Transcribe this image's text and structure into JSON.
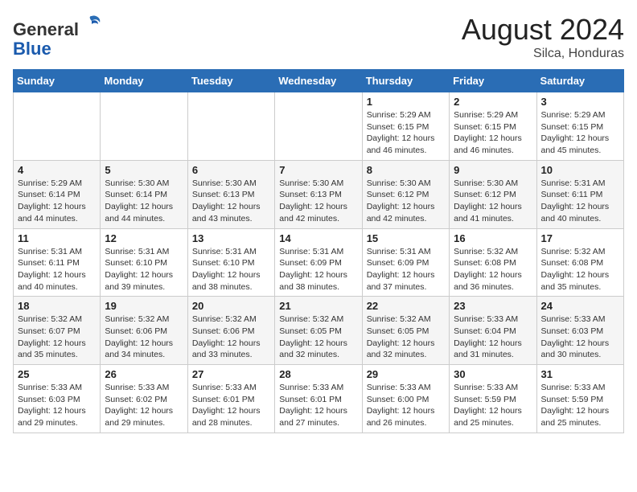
{
  "header": {
    "logo_line1": "General",
    "logo_line2": "Blue",
    "month_year": "August 2024",
    "location": "Silca, Honduras"
  },
  "days_of_week": [
    "Sunday",
    "Monday",
    "Tuesday",
    "Wednesday",
    "Thursday",
    "Friday",
    "Saturday"
  ],
  "weeks": [
    [
      {
        "day": "",
        "info": ""
      },
      {
        "day": "",
        "info": ""
      },
      {
        "day": "",
        "info": ""
      },
      {
        "day": "",
        "info": ""
      },
      {
        "day": "1",
        "info": "Sunrise: 5:29 AM\nSunset: 6:15 PM\nDaylight: 12 hours\nand 46 minutes."
      },
      {
        "day": "2",
        "info": "Sunrise: 5:29 AM\nSunset: 6:15 PM\nDaylight: 12 hours\nand 46 minutes."
      },
      {
        "day": "3",
        "info": "Sunrise: 5:29 AM\nSunset: 6:15 PM\nDaylight: 12 hours\nand 45 minutes."
      }
    ],
    [
      {
        "day": "4",
        "info": "Sunrise: 5:29 AM\nSunset: 6:14 PM\nDaylight: 12 hours\nand 44 minutes."
      },
      {
        "day": "5",
        "info": "Sunrise: 5:30 AM\nSunset: 6:14 PM\nDaylight: 12 hours\nand 44 minutes."
      },
      {
        "day": "6",
        "info": "Sunrise: 5:30 AM\nSunset: 6:13 PM\nDaylight: 12 hours\nand 43 minutes."
      },
      {
        "day": "7",
        "info": "Sunrise: 5:30 AM\nSunset: 6:13 PM\nDaylight: 12 hours\nand 42 minutes."
      },
      {
        "day": "8",
        "info": "Sunrise: 5:30 AM\nSunset: 6:12 PM\nDaylight: 12 hours\nand 42 minutes."
      },
      {
        "day": "9",
        "info": "Sunrise: 5:30 AM\nSunset: 6:12 PM\nDaylight: 12 hours\nand 41 minutes."
      },
      {
        "day": "10",
        "info": "Sunrise: 5:31 AM\nSunset: 6:11 PM\nDaylight: 12 hours\nand 40 minutes."
      }
    ],
    [
      {
        "day": "11",
        "info": "Sunrise: 5:31 AM\nSunset: 6:11 PM\nDaylight: 12 hours\nand 40 minutes."
      },
      {
        "day": "12",
        "info": "Sunrise: 5:31 AM\nSunset: 6:10 PM\nDaylight: 12 hours\nand 39 minutes."
      },
      {
        "day": "13",
        "info": "Sunrise: 5:31 AM\nSunset: 6:10 PM\nDaylight: 12 hours\nand 38 minutes."
      },
      {
        "day": "14",
        "info": "Sunrise: 5:31 AM\nSunset: 6:09 PM\nDaylight: 12 hours\nand 38 minutes."
      },
      {
        "day": "15",
        "info": "Sunrise: 5:31 AM\nSunset: 6:09 PM\nDaylight: 12 hours\nand 37 minutes."
      },
      {
        "day": "16",
        "info": "Sunrise: 5:32 AM\nSunset: 6:08 PM\nDaylight: 12 hours\nand 36 minutes."
      },
      {
        "day": "17",
        "info": "Sunrise: 5:32 AM\nSunset: 6:08 PM\nDaylight: 12 hours\nand 35 minutes."
      }
    ],
    [
      {
        "day": "18",
        "info": "Sunrise: 5:32 AM\nSunset: 6:07 PM\nDaylight: 12 hours\nand 35 minutes."
      },
      {
        "day": "19",
        "info": "Sunrise: 5:32 AM\nSunset: 6:06 PM\nDaylight: 12 hours\nand 34 minutes."
      },
      {
        "day": "20",
        "info": "Sunrise: 5:32 AM\nSunset: 6:06 PM\nDaylight: 12 hours\nand 33 minutes."
      },
      {
        "day": "21",
        "info": "Sunrise: 5:32 AM\nSunset: 6:05 PM\nDaylight: 12 hours\nand 32 minutes."
      },
      {
        "day": "22",
        "info": "Sunrise: 5:32 AM\nSunset: 6:05 PM\nDaylight: 12 hours\nand 32 minutes."
      },
      {
        "day": "23",
        "info": "Sunrise: 5:33 AM\nSunset: 6:04 PM\nDaylight: 12 hours\nand 31 minutes."
      },
      {
        "day": "24",
        "info": "Sunrise: 5:33 AM\nSunset: 6:03 PM\nDaylight: 12 hours\nand 30 minutes."
      }
    ],
    [
      {
        "day": "25",
        "info": "Sunrise: 5:33 AM\nSunset: 6:03 PM\nDaylight: 12 hours\nand 29 minutes."
      },
      {
        "day": "26",
        "info": "Sunrise: 5:33 AM\nSunset: 6:02 PM\nDaylight: 12 hours\nand 29 minutes."
      },
      {
        "day": "27",
        "info": "Sunrise: 5:33 AM\nSunset: 6:01 PM\nDaylight: 12 hours\nand 28 minutes."
      },
      {
        "day": "28",
        "info": "Sunrise: 5:33 AM\nSunset: 6:01 PM\nDaylight: 12 hours\nand 27 minutes."
      },
      {
        "day": "29",
        "info": "Sunrise: 5:33 AM\nSunset: 6:00 PM\nDaylight: 12 hours\nand 26 minutes."
      },
      {
        "day": "30",
        "info": "Sunrise: 5:33 AM\nSunset: 5:59 PM\nDaylight: 12 hours\nand 25 minutes."
      },
      {
        "day": "31",
        "info": "Sunrise: 5:33 AM\nSunset: 5:59 PM\nDaylight: 12 hours\nand 25 minutes."
      }
    ]
  ]
}
